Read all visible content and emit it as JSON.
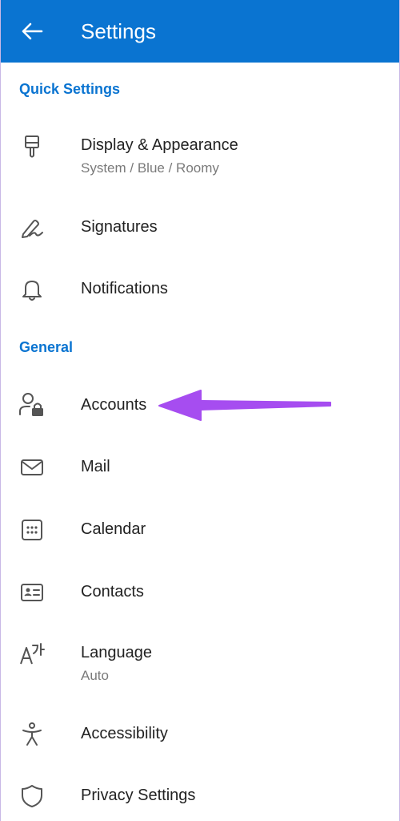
{
  "header": {
    "title": "Settings",
    "background": "#0a74d1"
  },
  "sections": {
    "quick": {
      "label": "Quick Settings"
    },
    "general": {
      "label": "General"
    }
  },
  "items": {
    "display": {
      "label": "Display & Appearance",
      "subtitle": "System / Blue / Roomy",
      "icon": "paintbrush-icon"
    },
    "signatures": {
      "label": "Signatures",
      "icon": "signature-pen-icon"
    },
    "notifications": {
      "label": "Notifications",
      "icon": "bell-icon"
    },
    "accounts": {
      "label": "Accounts",
      "icon": "user-lock-icon"
    },
    "mail": {
      "label": "Mail",
      "icon": "envelope-icon"
    },
    "calendar": {
      "label": "Calendar",
      "icon": "calendar-icon"
    },
    "contacts": {
      "label": "Contacts",
      "icon": "contact-card-icon"
    },
    "language": {
      "label": "Language",
      "subtitle": "Auto",
      "icon": "language-icon"
    },
    "accessibility": {
      "label": "Accessibility",
      "icon": "accessibility-icon"
    },
    "privacy": {
      "label": "Privacy Settings",
      "icon": "shield-icon"
    }
  },
  "colors": {
    "accent": "#0a74d1",
    "annotation_arrow": "#a64df0",
    "text": "#222222",
    "subtext": "#7a7a7a",
    "icon": "#555555"
  }
}
